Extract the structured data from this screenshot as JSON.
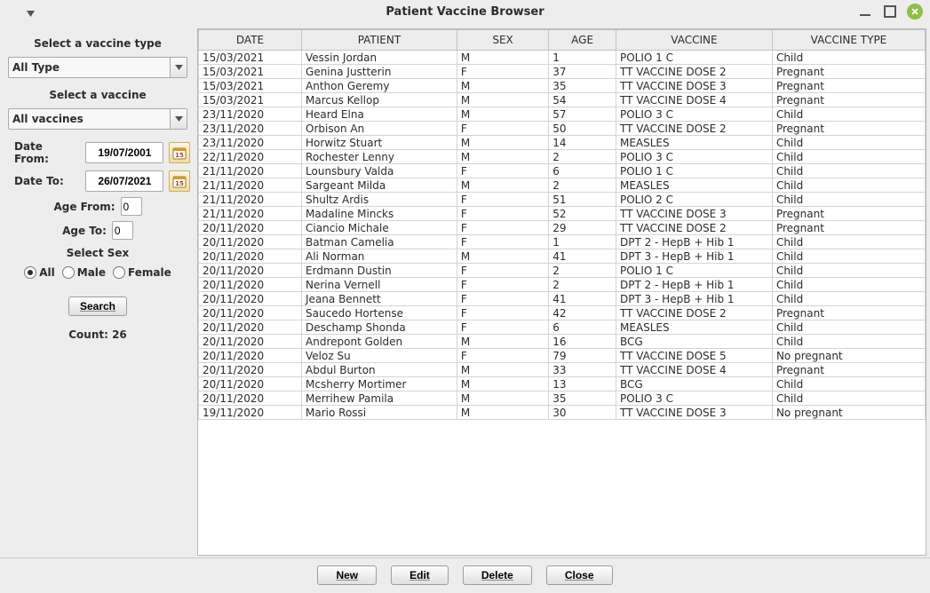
{
  "window": {
    "title": "Patient Vaccine Browser"
  },
  "sidebar": {
    "vaccine_type_label": "Select a vaccine type",
    "vaccine_type_value": "All Type",
    "vaccine_label": "Select a vaccine",
    "vaccine_value": "All vaccines",
    "date_from_label": "Date From:",
    "date_from_value": "19/07/2001",
    "date_to_label": "Date To:",
    "date_to_value": "26/07/2021",
    "age_from_label": "Age From:",
    "age_from_value": "0",
    "age_to_label": "Age To:",
    "age_to_value": "0",
    "sex_label": "Select Sex",
    "sex_options": {
      "all": "All",
      "male": "Male",
      "female": "Female"
    },
    "sex_selected": "all",
    "search_label": "Search",
    "count_label": "Count: 26"
  },
  "table": {
    "headers": {
      "date": "DATE",
      "patient": "PATIENT",
      "sex": "SEX",
      "age": "AGE",
      "vaccine": "VACCINE",
      "vaccine_type": "VACCINE TYPE"
    },
    "rows": [
      {
        "date": "15/03/2021",
        "patient": "Vessin Jordan",
        "sex": "M",
        "age": "1",
        "vaccine": "POLIO 1 C",
        "type": "Child"
      },
      {
        "date": "15/03/2021",
        "patient": "Genina Justterin",
        "sex": "F",
        "age": "37",
        "vaccine": "TT VACCINE DOSE 2",
        "type": "Pregnant"
      },
      {
        "date": "15/03/2021",
        "patient": "Anthon Geremy",
        "sex": "M",
        "age": "35",
        "vaccine": "TT VACCINE DOSE 3",
        "type": "Pregnant"
      },
      {
        "date": "15/03/2021",
        "patient": "Marcus Kellop",
        "sex": "M",
        "age": "54",
        "vaccine": "TT VACCINE DOSE 4",
        "type": "Pregnant"
      },
      {
        "date": "23/11/2020",
        "patient": "Heard Elna",
        "sex": "M",
        "age": "57",
        "vaccine": "POLIO 3 C",
        "type": "Child"
      },
      {
        "date": "23/11/2020",
        "patient": "Orbison An",
        "sex": "F",
        "age": "50",
        "vaccine": "TT VACCINE DOSE 2",
        "type": "Pregnant"
      },
      {
        "date": "23/11/2020",
        "patient": "Horwitz Stuart",
        "sex": "M",
        "age": "14",
        "vaccine": "MEASLES",
        "type": "Child"
      },
      {
        "date": "22/11/2020",
        "patient": "Rochester Lenny",
        "sex": "M",
        "age": "2",
        "vaccine": "POLIO 3 C",
        "type": "Child"
      },
      {
        "date": "21/11/2020",
        "patient": "Lounsbury Valda",
        "sex": "F",
        "age": "6",
        "vaccine": "POLIO 1 C",
        "type": "Child"
      },
      {
        "date": "21/11/2020",
        "patient": "Sargeant Milda",
        "sex": "M",
        "age": "2",
        "vaccine": "MEASLES",
        "type": "Child"
      },
      {
        "date": "21/11/2020",
        "patient": "Shultz Ardis",
        "sex": "F",
        "age": "51",
        "vaccine": "POLIO 2 C",
        "type": "Child"
      },
      {
        "date": "21/11/2020",
        "patient": "Madaline Mincks",
        "sex": "F",
        "age": "52",
        "vaccine": "TT VACCINE DOSE 3",
        "type": "Pregnant"
      },
      {
        "date": "20/11/2020",
        "patient": "Ciancio Michale",
        "sex": "F",
        "age": "29",
        "vaccine": "TT VACCINE DOSE 2",
        "type": "Pregnant"
      },
      {
        "date": "20/11/2020",
        "patient": "Batman Camelia",
        "sex": "F",
        "age": "1",
        "vaccine": "DPT 2 - HepB + Hib 1",
        "type": "Child"
      },
      {
        "date": "20/11/2020",
        "patient": "Ali Norman",
        "sex": "M",
        "age": "41",
        "vaccine": "DPT 3 - HepB + Hib 1",
        "type": "Child"
      },
      {
        "date": "20/11/2020",
        "patient": "Erdmann Dustin",
        "sex": "F",
        "age": "2",
        "vaccine": "POLIO 1 C",
        "type": "Child"
      },
      {
        "date": "20/11/2020",
        "patient": "Nerina Vernell",
        "sex": "F",
        "age": "2",
        "vaccine": "DPT 2 - HepB + Hib 1",
        "type": "Child"
      },
      {
        "date": "20/11/2020",
        "patient": "Jeana Bennett",
        "sex": "F",
        "age": "41",
        "vaccine": "DPT 3 - HepB + Hib 1",
        "type": "Child"
      },
      {
        "date": "20/11/2020",
        "patient": "Saucedo Hortense",
        "sex": "F",
        "age": "42",
        "vaccine": "TT VACCINE DOSE 2",
        "type": "Pregnant"
      },
      {
        "date": "20/11/2020",
        "patient": "Deschamp Shonda",
        "sex": "F",
        "age": "6",
        "vaccine": "MEASLES",
        "type": "Child"
      },
      {
        "date": "20/11/2020",
        "patient": "Andrepont Golden",
        "sex": "M",
        "age": "16",
        "vaccine": "BCG",
        "type": "Child"
      },
      {
        "date": "20/11/2020",
        "patient": "Veloz Su",
        "sex": "F",
        "age": "79",
        "vaccine": "TT VACCINE DOSE 5",
        "type": "No pregnant"
      },
      {
        "date": "20/11/2020",
        "patient": "Abdul Burton",
        "sex": "M",
        "age": "33",
        "vaccine": "TT VACCINE DOSE 4",
        "type": "Pregnant"
      },
      {
        "date": "20/11/2020",
        "patient": "Mcsherry Mortimer",
        "sex": "M",
        "age": "13",
        "vaccine": "BCG",
        "type": "Child"
      },
      {
        "date": "20/11/2020",
        "patient": "Merrihew Pamila",
        "sex": "M",
        "age": "35",
        "vaccine": "POLIO 3 C",
        "type": "Child"
      },
      {
        "date": "19/11/2020",
        "patient": "Mario Rossi",
        "sex": "M",
        "age": "30",
        "vaccine": "TT VACCINE DOSE 3",
        "type": "No pregnant"
      }
    ]
  },
  "footer": {
    "new": "New",
    "edit": "Edit",
    "delete": "Delete",
    "close": "Close"
  }
}
